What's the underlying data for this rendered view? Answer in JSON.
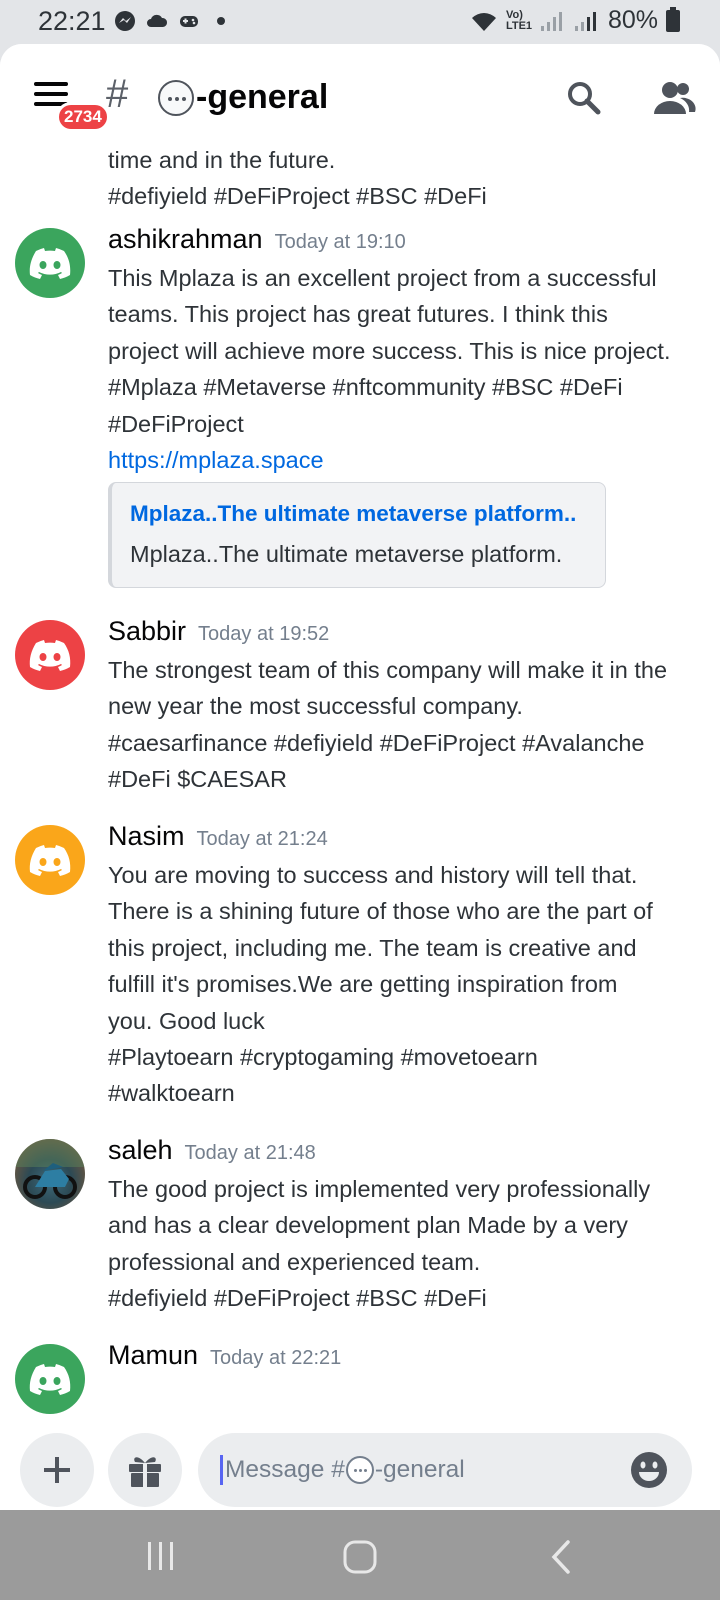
{
  "status_bar": {
    "time": "22:21",
    "battery": "80%",
    "network": "Vo) LTE1",
    "left_icons": [
      "messenger-icon",
      "cloud-icon",
      "gamepad-icon",
      "dot-icon"
    ]
  },
  "header": {
    "notification_badge": "2734",
    "hash": "#",
    "channel_name": "-general"
  },
  "messages": {
    "continuation": {
      "line1": "time and in the future.",
      "line2": "#defiyield #DeFiProject #BSC #DeFi"
    },
    "list": [
      {
        "username": "ashikrahman",
        "timestamp": "Today at 19:10",
        "avatar_color": "#3ba55d",
        "lines": [
          "This Mplaza is an excellent project from a successful",
          "teams. This project has great futures. I think this",
          "project will achieve more success. This is nice project.",
          "#Mplaza #Metaverse #nftcommunity #BSC  #DeFi",
          "#DeFiProject"
        ],
        "link": "https://mplaza.space",
        "embed_title": "Mplaza..The ultimate metaverse platform..",
        "embed_desc": "Mplaza..The ultimate metaverse platform."
      },
      {
        "username": "Sabbir",
        "timestamp": "Today at 19:52",
        "avatar_color": "#ed4245",
        "lines": [
          "The strongest team of this company will make it in the",
          "new year the most successful company.",
          "#caesarfinance #defiyield #DeFiProject #Avalanche",
          "#DeFi $CAESAR"
        ]
      },
      {
        "username": "Nasim",
        "timestamp": "Today at 21:24",
        "avatar_color": "#faa61a",
        "lines": [
          "You are moving to success and history will tell that.",
          "There is a shining future of those who are the part of",
          "this project, including me. The team is creative and",
          "fulfill it's promises.We are getting inspiration from",
          "you. Good luck",
          "#Playtoearn #cryptogaming #movetoearn",
          "#walktoearn"
        ]
      },
      {
        "username": "saleh",
        "timestamp": "Today at 21:48",
        "lines": [
          "The good project is implemented very professionally",
          "and has a clear development plan Made by a very",
          "professional and experienced team.",
          "#defiyield #DeFiProject #BSC #DeFi"
        ]
      },
      {
        "username": "Mamun",
        "timestamp": "Today at 22:21",
        "avatar_color": "#3ba55d"
      }
    ]
  },
  "input": {
    "placeholder_prefix": "Message #",
    "placeholder_suffix": "-general"
  },
  "colors": {
    "accent": "#5865f2",
    "link": "#0068e0",
    "badge": "#ed4245"
  }
}
